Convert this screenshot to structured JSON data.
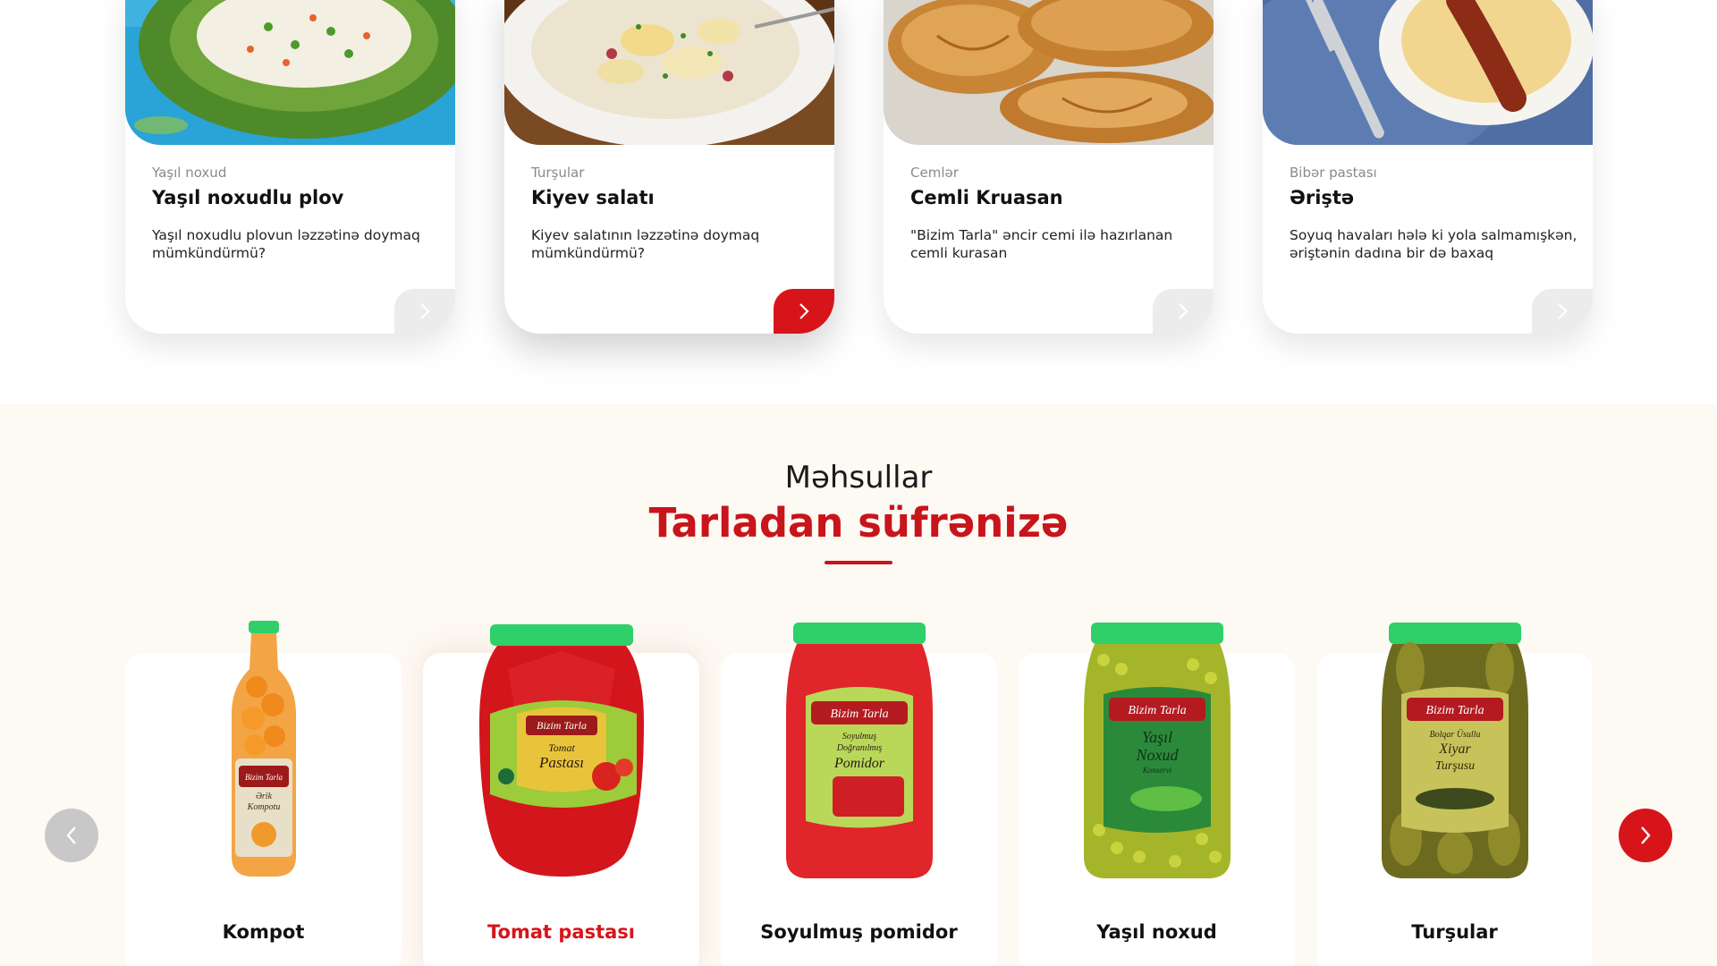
{
  "colors": {
    "brand_red": "#d7141a",
    "section_bg": "#fdf9f3",
    "lid_green": "#2fcf6a"
  },
  "recipes": [
    {
      "category": "Yaşıl noxud",
      "title": "Yaşıl noxudlu plov",
      "description": "Yaşıl noxudlu plovun ləzzətinə doymaq mümkündürmü?",
      "arrow": "chevron-right-icon",
      "active": false
    },
    {
      "category": "Turşular",
      "title": "Kiyev salatı",
      "description": "Kiyev salatının ləzzətinə doymaq mümkündürmü?",
      "arrow": "chevron-right-icon",
      "active": true
    },
    {
      "category": "Cemlər",
      "title": "Cemli Kruasan",
      "description": "\"Bizim Tarla\" əncir cemi ilə hazırlanan cemli kurasan",
      "arrow": "chevron-right-icon",
      "active": false
    },
    {
      "category": "Bibər pastası",
      "title": "Əriştə",
      "description": "Soyuq havaları hələ ki yola salmamışkən, əriştənin dadına bir də baxaq",
      "arrow": "chevron-right-icon",
      "active": false
    }
  ],
  "products_section": {
    "eyebrow": "Məhsullar",
    "headline": "Tarladan süfrənizə",
    "items": [
      {
        "name": "Kompot",
        "active": false
      },
      {
        "name": "Tomat pastası",
        "active": true
      },
      {
        "name": "Soyulmuş pomidor",
        "active": false
      },
      {
        "name": "Yaşıl noxud",
        "active": false
      },
      {
        "name": "Turşular",
        "active": false
      }
    ],
    "prev_icon": "chevron-left-icon",
    "next_icon": "chevron-right-icon"
  },
  "product_labels": {
    "brand": "Bizim Tarla",
    "kompot": [
      "Ərik",
      "Kompotu"
    ],
    "tomat": [
      "Tomat",
      "Pastası"
    ],
    "pomidor": [
      "Soyulmuş",
      "Doğranılmış",
      "Pomidor"
    ],
    "noxud": [
      "Yaşıl",
      "Noxud",
      "Konservi"
    ],
    "tursu": [
      "Bolqar Üsullu",
      "Xiyar",
      "Turşusu"
    ]
  }
}
